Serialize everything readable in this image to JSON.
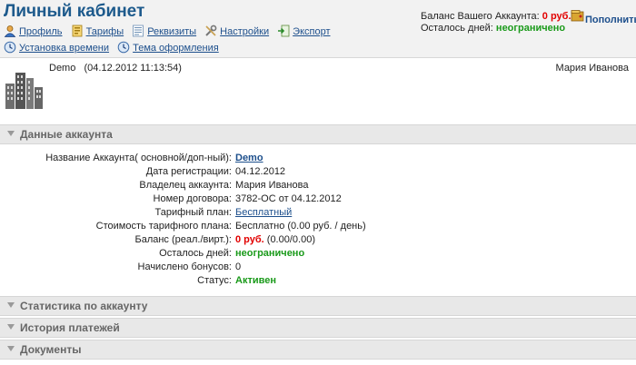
{
  "header": {
    "title": "Личный кабинет",
    "nav": [
      {
        "label": "Профиль",
        "icon": "profile-icon"
      },
      {
        "label": "Тарифы",
        "icon": "tariffs-icon"
      },
      {
        "label": "Реквизиты",
        "icon": "requisites-icon"
      },
      {
        "label": "Настройки",
        "icon": "settings-icon"
      },
      {
        "label": "Экспорт",
        "icon": "export-icon"
      },
      {
        "label": "Установка времени",
        "icon": "clock-icon"
      },
      {
        "label": "Тема оформления",
        "icon": "theme-icon"
      }
    ],
    "balance_label": "Баланс Вашего Аккаунта:",
    "balance_value": "0 руб.",
    "days_label": "Осталось дней:",
    "days_value": "неограничено",
    "topup_label": "Пополнить"
  },
  "user": {
    "login": "Demo   (04.12.2012 11:13:54)",
    "name": "Мария Иванова"
  },
  "sections": [
    {
      "label": "Данные аккаунта"
    },
    {
      "label": "Статистика по аккаунту"
    },
    {
      "label": "История платежей"
    },
    {
      "label": "Документы"
    }
  ],
  "account": {
    "name_label": "Название Аккаунта( основной/доп-ный):",
    "name_value": "Demo",
    "reg_label": "Дата регистрации:",
    "reg_value": "04.12.2012",
    "owner_label": "Владелец аккаунта:",
    "owner_value": "Мария Иванова",
    "contract_label": "Номер договора:",
    "contract_value": "3782-ОС от 04.12.2012",
    "plan_label": "Тарифный план:",
    "plan_value": "Бесплатный",
    "cost_label": "Стоимость тарифного плана:",
    "cost_value": "Бесплатно (0.00 руб. / день)",
    "balance_label": "Баланс (реал./вирт.):",
    "balance_red": "0 руб.",
    "balance_rest": "(0.00/0.00)",
    "days_label": "Осталось дней:",
    "days_value": "неограничено",
    "bonus_label": "Начислено бонусов:",
    "bonus_value": "0",
    "status_label": "Статус:",
    "status_value": "Активен"
  },
  "colors": {
    "title": "#1d5a8c",
    "link": "#1d4f8c",
    "red": "#e20000",
    "green": "#1a9a1a"
  }
}
